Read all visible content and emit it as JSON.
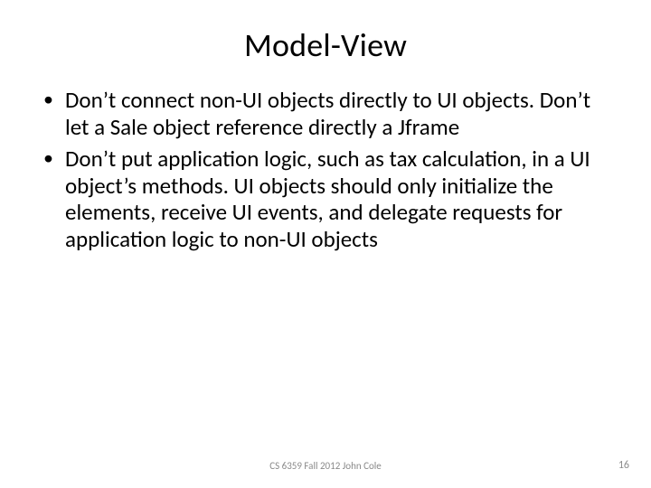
{
  "slide": {
    "title": "Model-View",
    "bullets": [
      "Don’t connect non-UI objects directly to UI objects.  Don’t let a Sale object reference directly a Jframe",
      "Don’t put application logic, such as tax calculation, in a UI object’s methods.  UI objects should only initialize the elements, receive UI events, and delegate requests for application logic to non-UI objects"
    ],
    "footer_center": "CS 6359 Fall 2012 John Cole",
    "page_number": "16"
  }
}
